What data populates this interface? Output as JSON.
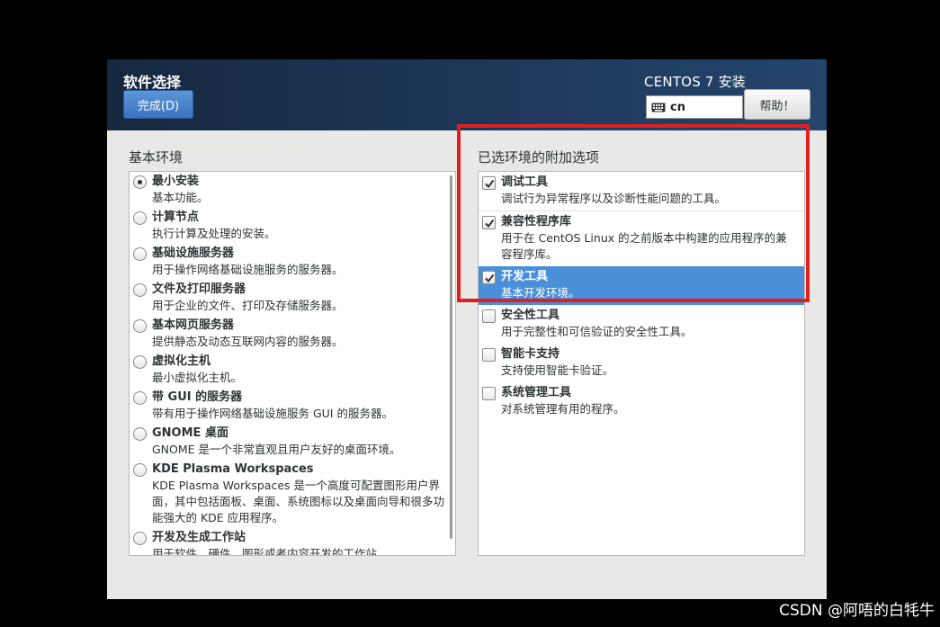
{
  "header": {
    "title": "软件选择",
    "done_label": "完成(D)",
    "product": "CENTOS 7 安装",
    "keyboard_layout": "cn",
    "help_label": "帮助！"
  },
  "base_environment": {
    "label": "基本环境",
    "items": [
      {
        "name": "最小安装",
        "desc": "基本功能。",
        "selected": true
      },
      {
        "name": "计算节点",
        "desc": "执行计算及处理的安装。"
      },
      {
        "name": "基础设施服务器",
        "desc": "用于操作网络基础设施服务的服务器。"
      },
      {
        "name": "文件及打印服务器",
        "desc": "用于企业的文件、打印及存储服务器。"
      },
      {
        "name": "基本网页服务器",
        "desc": "提供静态及动态互联网内容的服务器。"
      },
      {
        "name": "虚拟化主机",
        "desc": "最小虚拟化主机。"
      },
      {
        "name": "带 GUI 的服务器",
        "desc": "带有用于操作网络基础设施服务 GUI 的服务器。"
      },
      {
        "name": "GNOME 桌面",
        "desc": "GNOME 是一个非常直观且用户友好的桌面环境。"
      },
      {
        "name": "KDE Plasma Workspaces",
        "desc": "KDE Plasma Workspaces 是一个高度可配置图形用户界面，其中包括面板、桌面、系统图标以及桌面向导和很多功能强大的 KDE 应用程序。"
      },
      {
        "name": "开发及生成工作站",
        "desc": "用于软件、硬件、图形或者内容开发的工作站。"
      }
    ]
  },
  "addons": {
    "label": "已选环境的附加选项",
    "items": [
      {
        "name": "调试工具",
        "desc": "调试行为异常程序以及诊断性能问题的工具。",
        "checked": true
      },
      {
        "name": "兼容性程序库",
        "desc": "用于在 CentOS Linux 的之前版本中构建的应用程序的兼容程序库。",
        "checked": true
      },
      {
        "name": "开发工具",
        "desc": "基本开发环境。",
        "checked": true,
        "highlighted": true
      },
      {
        "name": "安全性工具",
        "desc": "用于完整性和可信验证的安全性工具。",
        "checked": false
      },
      {
        "name": "智能卡支持",
        "desc": "支持使用智能卡验证。",
        "checked": false
      },
      {
        "name": "系统管理工具",
        "desc": "对系统管理有用的程序。",
        "checked": false
      }
    ]
  },
  "watermark": "CSDN @阿唔的白牦牛",
  "colors": {
    "selection": "#4a90d9",
    "annotation_box": "#e02020",
    "header": "#1d3556"
  }
}
